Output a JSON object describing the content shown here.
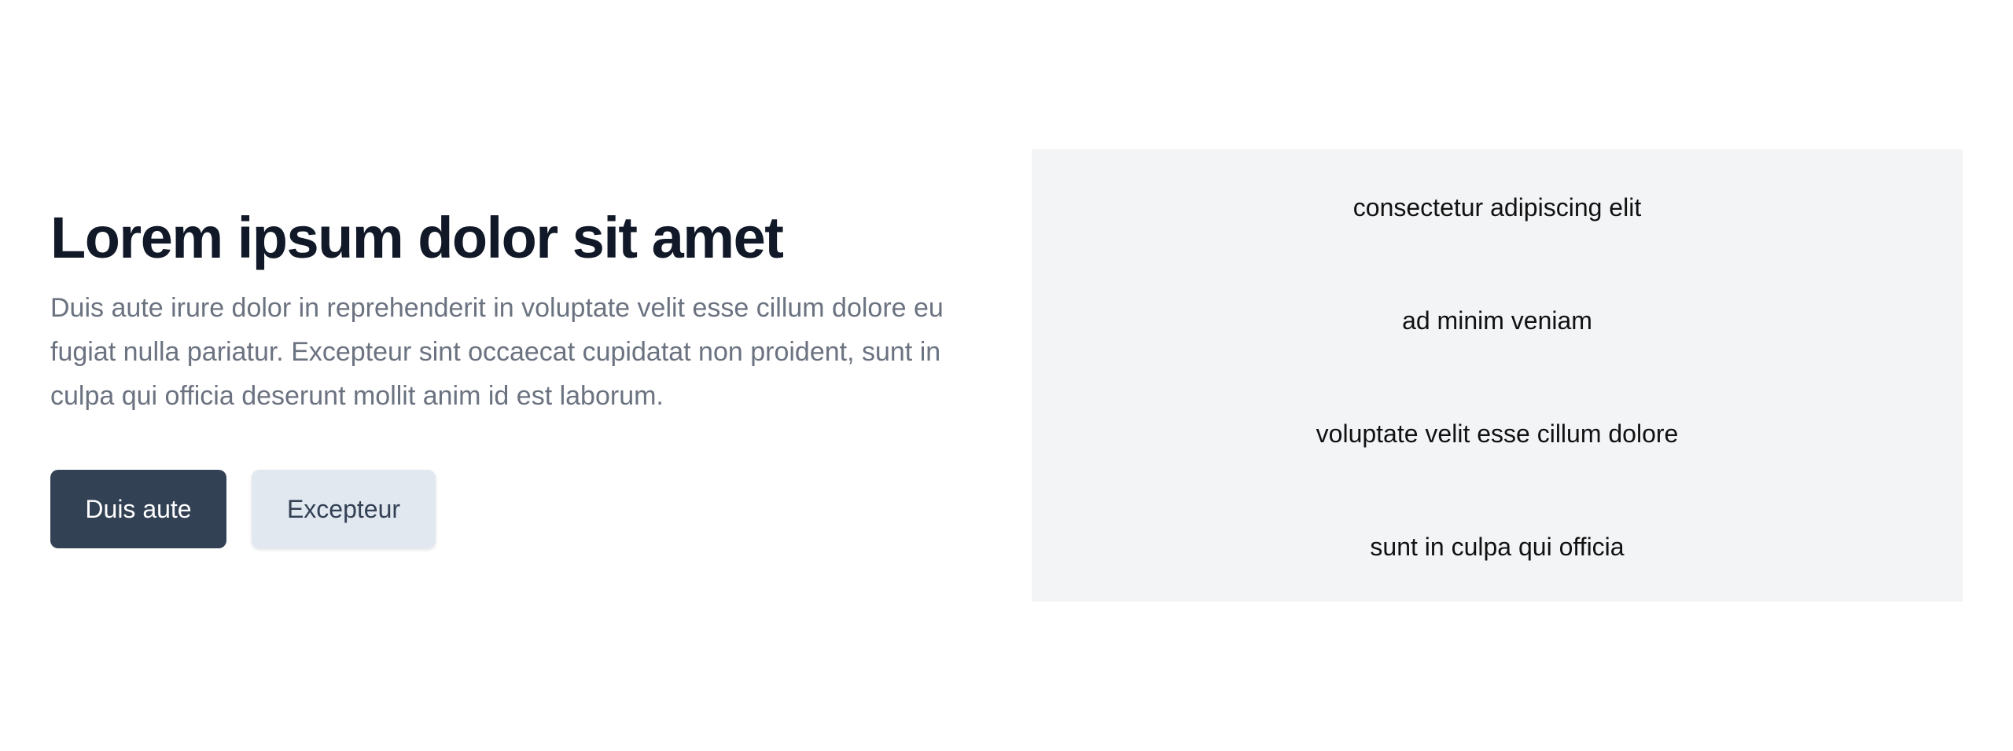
{
  "hero": {
    "title": "Lorem ipsum dolor sit amet",
    "description": "Duis aute irure dolor in reprehenderit in voluptate velit esse cillum dolore eu fugiat nulla pariatur. Excepteur sint occaecat cupidatat non proident, sunt in culpa qui officia deserunt mollit anim id est laborum.",
    "primary_button": "Duis aute",
    "secondary_button": "Excepteur"
  },
  "features": {
    "items": [
      "consectetur adipiscing elit",
      "ad minim veniam",
      "voluptate velit esse cillum dolore",
      "sunt in culpa qui officia"
    ]
  },
  "colors": {
    "title": "#111827",
    "description": "#6b7280",
    "primary_button_bg": "#334155",
    "secondary_button_bg": "#e2e8f0",
    "panel_bg": "#f3f4f6"
  }
}
